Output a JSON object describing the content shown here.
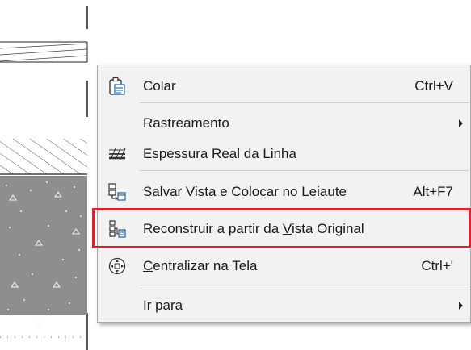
{
  "context_menu": {
    "items": [
      {
        "label": "Colar",
        "shortcut": "Ctrl+V",
        "icon": "clipboard-icon"
      },
      {
        "label": "Rastreamento",
        "submenu": true
      },
      {
        "label": "Espessura Real da Linha",
        "icon": "line-weight-icon"
      },
      {
        "label": "Salvar Vista e Colocar no Leiaute",
        "shortcut": "Alt+F7",
        "icon": "save-view-icon"
      },
      {
        "label_before": "Reconstruir a partir da ",
        "label_underline": "V",
        "label_after": "ista Original",
        "icon": "rebuild-view-icon",
        "highlighted": true
      },
      {
        "label_underline": "C",
        "label_after": "entralizar na Tela",
        "shortcut": "Ctrl+'",
        "icon": "fit-screen-icon"
      },
      {
        "label": "Ir para",
        "submenu": true
      }
    ]
  },
  "colors": {
    "menu_bg": "#f2f2f2",
    "highlight_border": "#d0262f",
    "icon_blue": "#2f6db3"
  }
}
